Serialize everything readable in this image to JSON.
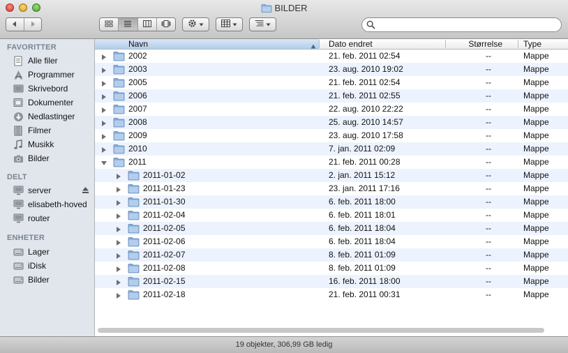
{
  "window": {
    "title": "BILDER"
  },
  "toolbar": {
    "back_icon": "chevron-left-icon",
    "forward_icon": "chevron-right-icon",
    "views": [
      {
        "name": "icon-view",
        "icon": "grid-icon",
        "active": false
      },
      {
        "name": "list-view",
        "icon": "list-icon",
        "active": true
      },
      {
        "name": "column-view",
        "icon": "columns-icon",
        "active": false
      },
      {
        "name": "coverflow-view",
        "icon": "coverflow-icon",
        "active": false
      }
    ],
    "action_icon": "gear-icon",
    "arrange_icon": "arrange-icon",
    "share_icon": "share-icon",
    "search": {
      "value": "",
      "placeholder": ""
    }
  },
  "sidebar": {
    "favorites_header": "FAVORITTER",
    "favorites": [
      {
        "label": "Alle filer",
        "icon": "all-files-icon"
      },
      {
        "label": "Programmer",
        "icon": "applications-icon"
      },
      {
        "label": "Skrivebord",
        "icon": "desktop-icon"
      },
      {
        "label": "Dokumenter",
        "icon": "documents-icon"
      },
      {
        "label": "Nedlastinger",
        "icon": "downloads-icon"
      },
      {
        "label": "Filmer",
        "icon": "movies-icon"
      },
      {
        "label": "Musikk",
        "icon": "music-icon"
      },
      {
        "label": "Bilder",
        "icon": "camera-icon"
      }
    ],
    "shared_header": "DELT",
    "shared": [
      {
        "label": "server",
        "icon": "computer-icon",
        "eject": true
      },
      {
        "label": "elisabeth-hoved",
        "icon": "computer-icon",
        "eject": false
      },
      {
        "label": "router",
        "icon": "computer-icon",
        "eject": false
      }
    ],
    "devices_header": "ENHETER",
    "devices": [
      {
        "label": "Lager",
        "icon": "disk-icon"
      },
      {
        "label": "iDisk",
        "icon": "disk-icon"
      },
      {
        "label": "Bilder",
        "icon": "disk-icon"
      }
    ]
  },
  "columns": {
    "name": "Navn",
    "date": "Dato endret",
    "size": "Størrelse",
    "type": "Type"
  },
  "files": [
    {
      "name": "2002",
      "date": "21. feb. 2011 02:54",
      "size": "--",
      "type": "Mappe",
      "level": 0,
      "expanded": false
    },
    {
      "name": "2003",
      "date": "23. aug. 2010 19:02",
      "size": "--",
      "type": "Mappe",
      "level": 0,
      "expanded": false
    },
    {
      "name": "2005",
      "date": "21. feb. 2011 02:54",
      "size": "--",
      "type": "Mappe",
      "level": 0,
      "expanded": false
    },
    {
      "name": "2006",
      "date": "21. feb. 2011 02:55",
      "size": "--",
      "type": "Mappe",
      "level": 0,
      "expanded": false
    },
    {
      "name": "2007",
      "date": "22. aug. 2010 22:22",
      "size": "--",
      "type": "Mappe",
      "level": 0,
      "expanded": false
    },
    {
      "name": "2008",
      "date": "25. aug. 2010 14:57",
      "size": "--",
      "type": "Mappe",
      "level": 0,
      "expanded": false
    },
    {
      "name": "2009",
      "date": "23. aug. 2010 17:58",
      "size": "--",
      "type": "Mappe",
      "level": 0,
      "expanded": false
    },
    {
      "name": "2010",
      "date": "7. jan. 2011 02:09",
      "size": "--",
      "type": "Mappe",
      "level": 0,
      "expanded": false
    },
    {
      "name": "2011",
      "date": "21. feb. 2011 00:28",
      "size": "--",
      "type": "Mappe",
      "level": 0,
      "expanded": true
    },
    {
      "name": "2011-01-02",
      "date": "2. jan. 2011 15:12",
      "size": "--",
      "type": "Mappe",
      "level": 1,
      "expanded": false
    },
    {
      "name": "2011-01-23",
      "date": "23. jan. 2011 17:16",
      "size": "--",
      "type": "Mappe",
      "level": 1,
      "expanded": false
    },
    {
      "name": "2011-01-30",
      "date": "6. feb. 2011 18:00",
      "size": "--",
      "type": "Mappe",
      "level": 1,
      "expanded": false
    },
    {
      "name": "2011-02-04",
      "date": "6. feb. 2011 18:01",
      "size": "--",
      "type": "Mappe",
      "level": 1,
      "expanded": false
    },
    {
      "name": "2011-02-05",
      "date": "6. feb. 2011 18:04",
      "size": "--",
      "type": "Mappe",
      "level": 1,
      "expanded": false
    },
    {
      "name": "2011-02-06",
      "date": "6. feb. 2011 18:04",
      "size": "--",
      "type": "Mappe",
      "level": 1,
      "expanded": false
    },
    {
      "name": "2011-02-07",
      "date": "8. feb. 2011 01:09",
      "size": "--",
      "type": "Mappe",
      "level": 1,
      "expanded": false
    },
    {
      "name": "2011-02-08",
      "date": "8. feb. 2011 01:09",
      "size": "--",
      "type": "Mappe",
      "level": 1,
      "expanded": false
    },
    {
      "name": "2011-02-15",
      "date": "16. feb. 2011 18:00",
      "size": "--",
      "type": "Mappe",
      "level": 1,
      "expanded": false
    },
    {
      "name": "2011-02-18",
      "date": "21. feb. 2011 00:31",
      "size": "--",
      "type": "Mappe",
      "level": 1,
      "expanded": false
    }
  ],
  "status": {
    "text": "19 objekter, 306,99 GB ledig"
  },
  "colors": {
    "sidebar_bg": "#e1e6ed",
    "row_alt": "#edf3fe",
    "folder_blue": "#9fbfe3",
    "section_header": "#7a8492"
  }
}
